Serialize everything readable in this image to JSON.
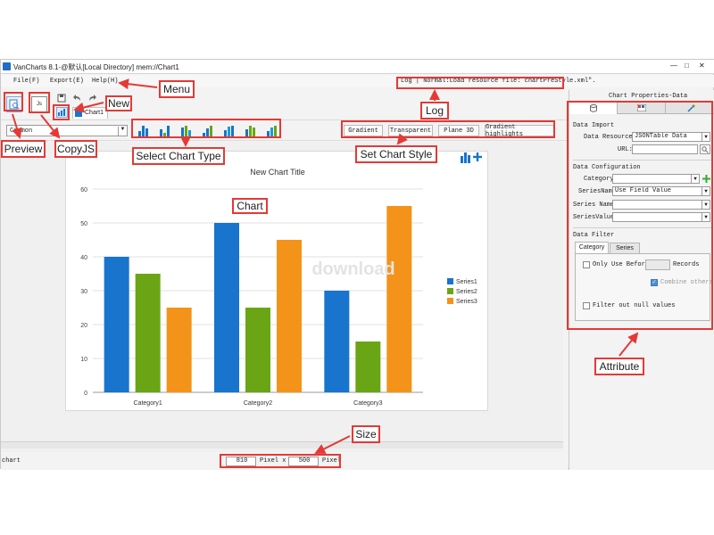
{
  "window": {
    "title": "VanCharts 8.1-@默认[Local Directory]   mem://Chart1",
    "controls": [
      "—",
      "□",
      "✕"
    ]
  },
  "menu": {
    "items": [
      "File(F)",
      "Export(E)",
      "Help(H)"
    ]
  },
  "log": {
    "text": "Log | Normal:Load resource file: chartPreStyle.xml\"."
  },
  "tab": {
    "label": "Chart1"
  },
  "font_select": {
    "value": "Common"
  },
  "style_buttons": [
    "Gradient",
    "Transparent",
    "Plane 3D",
    "Gradient highlights"
  ],
  "chart_data": {
    "type": "bar",
    "title": "New Chart Title",
    "categories": [
      "Category1",
      "Category2",
      "Category3"
    ],
    "series": [
      {
        "name": "Series1",
        "values": [
          40,
          50,
          30
        ],
        "color": "#1874cd"
      },
      {
        "name": "Series2",
        "values": [
          35,
          25,
          15
        ],
        "color": "#6aa515"
      },
      {
        "name": "Series3",
        "values": [
          25,
          45,
          55
        ],
        "color": "#f4931a"
      }
    ],
    "ylim": [
      0,
      60
    ],
    "yticks": [
      "0",
      "10",
      "20",
      "30",
      "40",
      "50",
      "60"
    ],
    "grid": true,
    "legend": "right"
  },
  "watermark": "download",
  "status": {
    "left_label": "chart",
    "width_value": "810",
    "pixel_x_label": "Pixel x",
    "height_value": "500",
    "pixel_label": "Pixel"
  },
  "properties": {
    "title": "Chart Properties-Data",
    "data_import": "Data Import",
    "data_resource_label": "Data Resource:",
    "data_resource_value": "JSONTable Data",
    "url_label": "URL:",
    "data_config": "Data Configuration",
    "category_label": "Category:",
    "seriesname1_label": "SeriesName:",
    "seriesname1_value": "Use Field Value",
    "series_name_label": "Series Name:",
    "series_value_label": "SeriesValue:",
    "data_filter": "Data Filter",
    "filter_tabs": [
      "Category",
      "Series"
    ],
    "only_use_before": "Only Use Before",
    "records": "Records",
    "combine_others": "Combine others",
    "filter_null": "Filter out null values"
  },
  "callouts": {
    "menu": "Menu",
    "new": "New",
    "log": "Log",
    "preview": "Preview",
    "copyjs": "CopyJS",
    "select_chart_type": "Select Chart Type",
    "set_chart_style": "Set Chart Style",
    "chart": "Chart",
    "size": "Size",
    "attribute": "Attribute"
  },
  "colors": {
    "annotation": "#e53935",
    "series1": "#1874cd",
    "series2": "#6aa515",
    "series3": "#f4931a"
  }
}
